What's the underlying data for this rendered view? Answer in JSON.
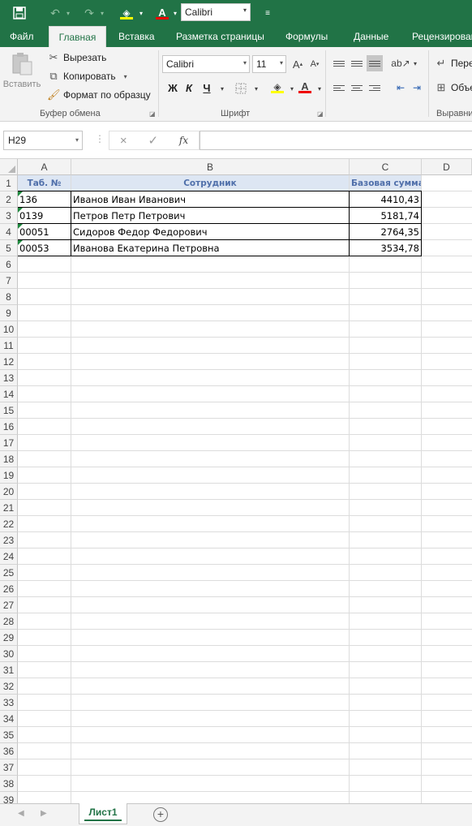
{
  "qat": {
    "save_icon": "save-icon",
    "undo_icon": "undo-icon",
    "redo_icon": "redo-icon",
    "fill_color_icon": "fill-color-icon",
    "font_color_icon": "font-color-icon",
    "font": "Calibri",
    "customize_icon": "customize-qat-icon"
  },
  "tabs": [
    "Файл",
    "Главная",
    "Вставка",
    "Разметка страницы",
    "Формулы",
    "Данные",
    "Рецензирован"
  ],
  "active_tab": "Главная",
  "ribbon": {
    "clipboard": {
      "paste_label": "Вставить",
      "cut_label": "Вырезать",
      "copy_label": "Копировать",
      "format_painter_label": "Формат по образцу",
      "group_label": "Буфер обмена"
    },
    "font": {
      "font_name": "Calibri",
      "font_size": "11",
      "bold_label": "Ж",
      "italic_label": "К",
      "underline_label": "Ч",
      "group_label": "Шрифт"
    },
    "alignment": {
      "wrap_label": "Перен",
      "merge_label": "Объе",
      "group_label": "Выравни"
    }
  },
  "formula_bar": {
    "name_box": "H29",
    "cancel_icon": "×",
    "enter_icon": "✓",
    "fx_label": "fx",
    "formula": ""
  },
  "columns": [
    "A",
    "B",
    "C",
    "D"
  ],
  "rows": [
    "1",
    "2",
    "3",
    "4",
    "5",
    "6",
    "7",
    "8",
    "9",
    "10",
    "11",
    "12",
    "13",
    "14",
    "15",
    "16",
    "17",
    "18",
    "19",
    "20",
    "21",
    "22",
    "23",
    "24",
    "25",
    "26",
    "27",
    "28",
    "29",
    "30",
    "31",
    "32",
    "33",
    "34",
    "35",
    "36",
    "37",
    "38",
    "39"
  ],
  "table": {
    "headers": [
      "Таб. №",
      "Сотрудник",
      "Базовая сумма"
    ],
    "rows": [
      [
        "136",
        "Иванов Иван Иванович",
        "4410,43"
      ],
      [
        "0139",
        "Петров Петр Петрович",
        "5181,74"
      ],
      [
        "00051",
        "Сидоров Федор Федорович",
        "2764,35"
      ],
      [
        "00053",
        "Иванова Екатерина Петровна",
        "3534,78"
      ]
    ]
  },
  "sheets": [
    "Лист1"
  ],
  "colors": {
    "accent": "#217346",
    "header_text": "#4f6faa",
    "header_fill": "#dde6f3"
  }
}
